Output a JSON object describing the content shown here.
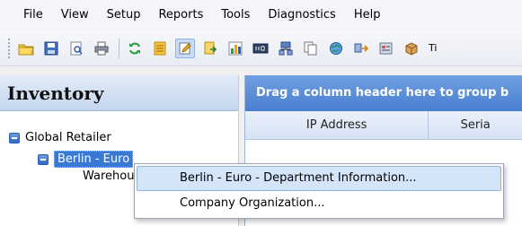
{
  "menubar": {
    "items": [
      "File",
      "View",
      "Setup",
      "Reports",
      "Tools",
      "Diagnostics",
      "Help"
    ]
  },
  "toolbar": {
    "icons": [
      "open-folder-icon",
      "save-icon",
      "print-preview-icon",
      "print-icon",
      "refresh-icon",
      "list-icon",
      "edit-icon",
      "export-icon",
      "chart-icon",
      "counter-icon",
      "network-icon",
      "copy-icon",
      "globe-icon",
      "transfer-icon",
      "report-icon",
      "box-icon"
    ],
    "clipped_text": "Ti"
  },
  "left_panel": {
    "title": "Inventory",
    "tree": [
      {
        "label": "Global Retailer"
      },
      {
        "label": "Berlin - Euro"
      },
      {
        "label": "Warehou"
      }
    ]
  },
  "right_panel": {
    "group_hint": "Drag a column header here to group b",
    "columns": [
      "IP Address",
      "Seria"
    ]
  },
  "context_menu": {
    "items": [
      "Berlin - Euro - Department Information...",
      "Company Organization..."
    ]
  }
}
